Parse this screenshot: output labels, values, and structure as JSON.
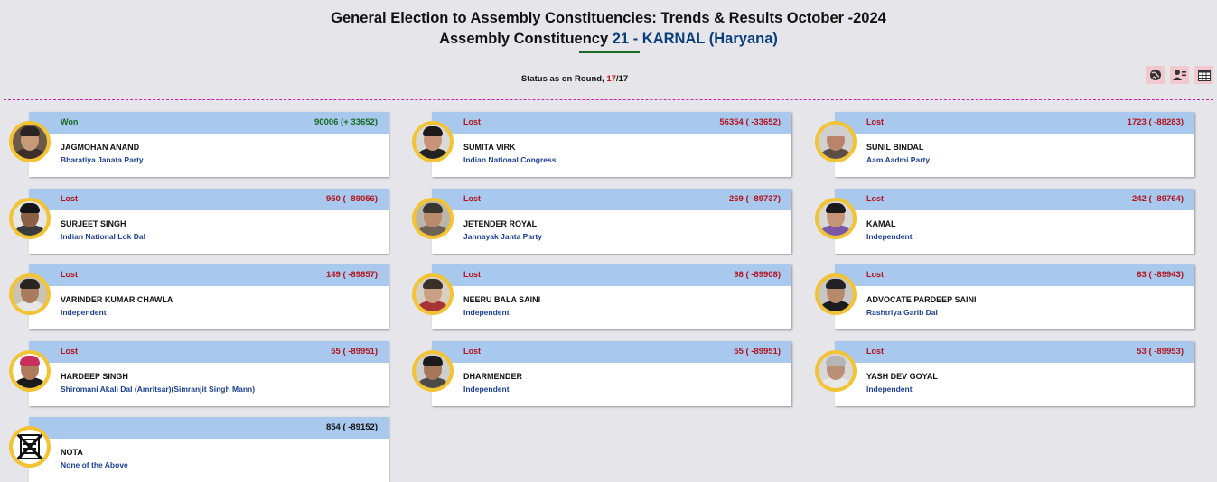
{
  "header": {
    "title_line1": "General Election to Assembly Constituencies: Trends & Results October -2024",
    "title_prefix": "Assembly Constituency",
    "constituency_number": "21",
    "separator": "-",
    "constituency_name": "KARNAL",
    "state": "(Haryana)"
  },
  "status": {
    "label": "Status as on Round,",
    "current_round": "17",
    "total_rounds": "/17"
  },
  "toolbar": {
    "icons": [
      "globe-icon",
      "user-list-icon",
      "table-icon"
    ]
  },
  "colors": {
    "won": "#16691f",
    "lost": "#b3121a",
    "header_bar": "#a8c8ee",
    "party": "#1b3f93",
    "photo_ring": "#f1c335",
    "divider": "#c21fb8"
  },
  "candidates": [
    {
      "status": "Won",
      "votes": "90006 (+ 33652)",
      "name": "JAGMOHAN ANAND",
      "party": "Bharatiya Janata Party"
    },
    {
      "status": "Lost",
      "votes": "56354 ( -33652)",
      "name": "SUMITA VIRK",
      "party": "Indian National Congress"
    },
    {
      "status": "Lost",
      "votes": "1723 ( -88283)",
      "name": "SUNIL BINDAL",
      "party": "Aam Aadmi Party"
    },
    {
      "status": "Lost",
      "votes": "950 ( -89056)",
      "name": "SURJEET SINGH",
      "party": "Indian National Lok Dal"
    },
    {
      "status": "Lost",
      "votes": "269 ( -89737)",
      "name": "JETENDER ROYAL",
      "party": "Jannayak Janta Party"
    },
    {
      "status": "Lost",
      "votes": "242 ( -89764)",
      "name": "KAMAL",
      "party": "Independent"
    },
    {
      "status": "Lost",
      "votes": "149 ( -89857)",
      "name": "VARINDER KUMAR CHAWLA",
      "party": "Independent"
    },
    {
      "status": "Lost",
      "votes": "98 ( -89908)",
      "name": "NEERU BALA SAINI",
      "party": "Independent"
    },
    {
      "status": "Lost",
      "votes": "63 ( -89943)",
      "name": "ADVOCATE PARDEEP SAINI",
      "party": "Rashtriya Garib Dal"
    },
    {
      "status": "Lost",
      "votes": "55 ( -89951)",
      "name": "HARDEEP SINGH",
      "party": "Shiromani Akali Dal (Amritsar)(Simranjit Singh Mann)"
    },
    {
      "status": "Lost",
      "votes": "55 ( -89951)",
      "name": "DHARMENDER",
      "party": "Independent"
    },
    {
      "status": "Lost",
      "votes": "53 ( -89953)",
      "name": "YASH DEV GOYAL",
      "party": "Independent"
    },
    {
      "status": "",
      "votes": "854 ( -89152)",
      "name": "NOTA",
      "party": "None of the Above"
    }
  ]
}
